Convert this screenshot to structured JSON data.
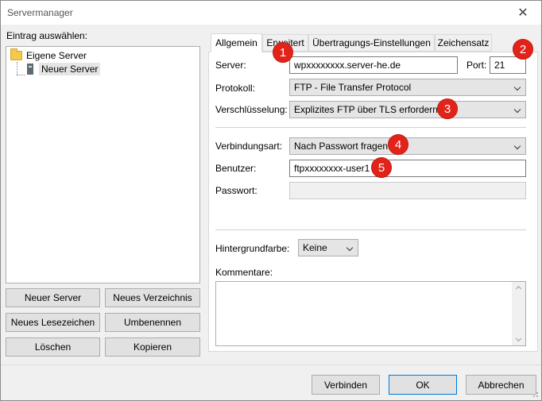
{
  "window": {
    "title": "Servermanager",
    "close_glyph": "✕"
  },
  "left": {
    "label": "Eintrag auswählen:",
    "tree": {
      "root": "Eigene Server",
      "child": "Neuer Server"
    },
    "buttons": {
      "new_server": "Neuer Server",
      "new_folder": "Neues Verzeichnis",
      "new_bookmark": "Neues Lesezeichen",
      "rename": "Umbenennen",
      "delete": "Löschen",
      "copy": "Kopieren"
    }
  },
  "tabs": [
    "Allgemein",
    "Erweitert",
    "Übertragungs-Einstellungen",
    "Zeichensatz"
  ],
  "general": {
    "server_label": "Server:",
    "server_value": "wpxxxxxxxx.server-he.de",
    "port_label": "Port:",
    "port_value": "21",
    "protocol_label": "Protokoll:",
    "protocol_value": "FTP - File Transfer Protocol",
    "encryption_label": "Verschlüsselung:",
    "encryption_value": "Explizites FTP über TLS erfordern",
    "login_type_label": "Verbindungsart:",
    "login_type_value": "Nach Passwort fragen",
    "user_label": "Benutzer:",
    "user_value": "ftpxxxxxxxx-user1",
    "password_label": "Passwort:",
    "background_label": "Hintergrundfarbe:",
    "background_value": "Keine",
    "comments_label": "Kommentare:"
  },
  "badges": [
    "1",
    "2",
    "3",
    "4",
    "5"
  ],
  "footer": {
    "connect": "Verbinden",
    "ok": "OK",
    "cancel": "Abbrechen"
  },
  "colors": {
    "badge": "#e2231a"
  }
}
